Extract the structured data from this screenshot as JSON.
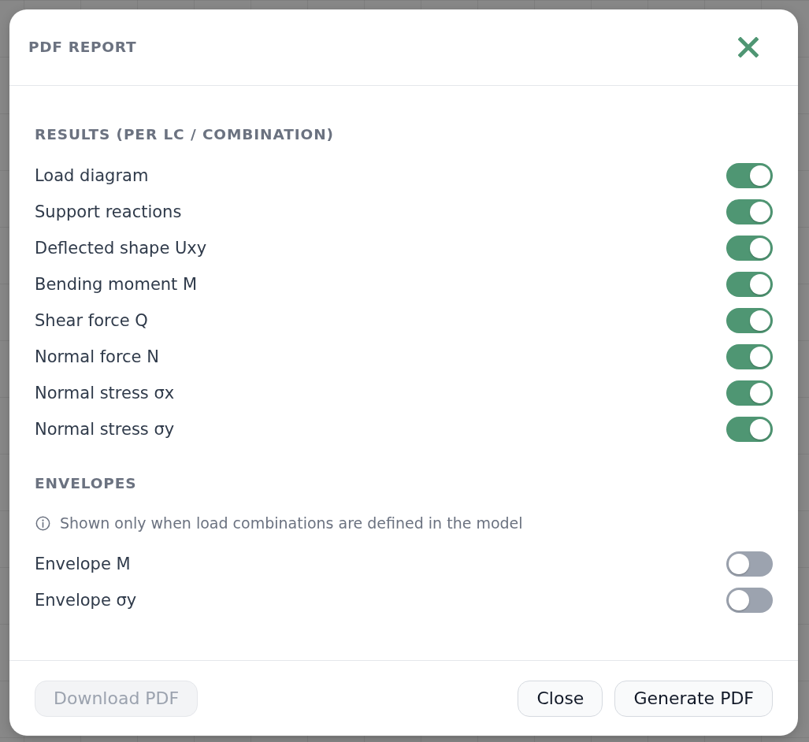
{
  "dialog": {
    "title": "PDF REPORT"
  },
  "sections": [
    {
      "heading": "RESULTS (PER LC / COMBINATION)",
      "options": [
        {
          "label": "Load diagram",
          "on": true
        },
        {
          "label": "Support reactions",
          "on": true
        },
        {
          "label": "Deflected shape Uxy",
          "on": true
        },
        {
          "label": "Bending moment M",
          "on": true
        },
        {
          "label": "Shear force Q",
          "on": true
        },
        {
          "label": "Normal force N",
          "on": true
        },
        {
          "label": "Normal stress σx",
          "on": true
        },
        {
          "label": "Normal stress σy",
          "on": true
        }
      ]
    },
    {
      "heading": "ENVELOPES",
      "note": "Shown only when load combinations are defined in the model",
      "options": [
        {
          "label": "Envelope M",
          "on": false
        },
        {
          "label": "Envelope σy",
          "on": false
        }
      ]
    }
  ],
  "footer": {
    "left_buttons": [
      {
        "label": "Download PDF",
        "disabled": true
      }
    ],
    "right_buttons": [
      {
        "label": "Close",
        "disabled": false
      },
      {
        "label": "Generate PDF",
        "disabled": false
      }
    ]
  }
}
